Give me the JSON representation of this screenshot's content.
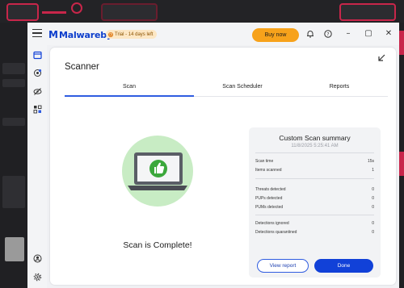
{
  "app": {
    "name": "Malwarebytes",
    "trial_badge": "Trial - 14 days left",
    "buy_now": "Buy now"
  },
  "scanner": {
    "title": "Scanner",
    "tabs": [
      {
        "label": "Scan",
        "active": true
      },
      {
        "label": "Scan Scheduler",
        "active": false
      },
      {
        "label": "Reports",
        "active": false
      }
    ],
    "status": "Scan is Complete!"
  },
  "summary": {
    "title": "Custom Scan summary",
    "date": "11/8/2025 5:25:41 AM",
    "rows": [
      {
        "label": "Scan time",
        "value": "15s"
      },
      {
        "label": "Items scanned",
        "value": "1"
      },
      {
        "label": "Threats detected",
        "value": "0"
      },
      {
        "label": "PUPs detected",
        "value": "0"
      },
      {
        "label": "PUMs detected",
        "value": "0"
      },
      {
        "label": "Detections ignored",
        "value": "0"
      },
      {
        "label": "Detections quarantined",
        "value": "0"
      }
    ],
    "view_report": "View report",
    "done": "Done"
  },
  "icons": {
    "menu": "hamburger-icon",
    "bell": "bell-icon",
    "help": "help-icon",
    "dashboard": "dashboard-icon",
    "scan": "scan-icon",
    "privacy": "eye-slash-icon",
    "tools": "tools-icon",
    "account": "account-icon",
    "settings": "gear-icon",
    "collapse": "collapse-arrow-icon",
    "thumbs_up": "thumbs-up-icon"
  },
  "colors": {
    "accent": "#1141d8",
    "brand": "#0d3ecc",
    "buy": "#f7a21b",
    "success": "#3ba83b",
    "success_light": "#c8ecc4"
  }
}
